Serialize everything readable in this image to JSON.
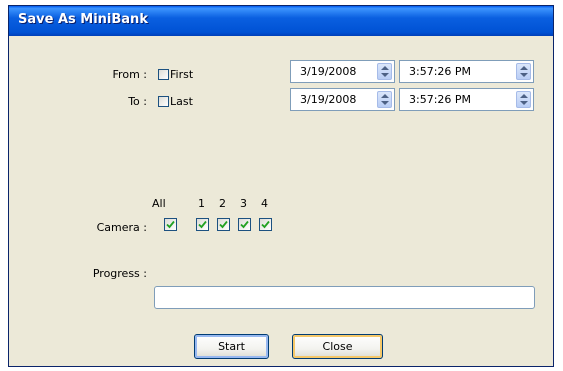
{
  "window": {
    "title": "Save As MiniBank"
  },
  "from": {
    "label": "From :",
    "checkbox_label": "First",
    "checked": false,
    "date": "3/19/2008",
    "time": "3:57:26 PM"
  },
  "to": {
    "label": "To :",
    "checkbox_label": "Last",
    "checked": false,
    "date": "3/19/2008",
    "time": "3:57:26 PM"
  },
  "camera": {
    "label": "Camera :",
    "headers": [
      "All",
      "1",
      "2",
      "3",
      "4"
    ],
    "checked": [
      true,
      true,
      true,
      true,
      true
    ]
  },
  "progress": {
    "label": "Progress :",
    "value": 0
  },
  "buttons": {
    "start": "Start",
    "close": "Close"
  },
  "colors": {
    "titlebar": "#0058ee",
    "dialog_bg": "#ece9d8",
    "field_border": "#7f9db9"
  }
}
